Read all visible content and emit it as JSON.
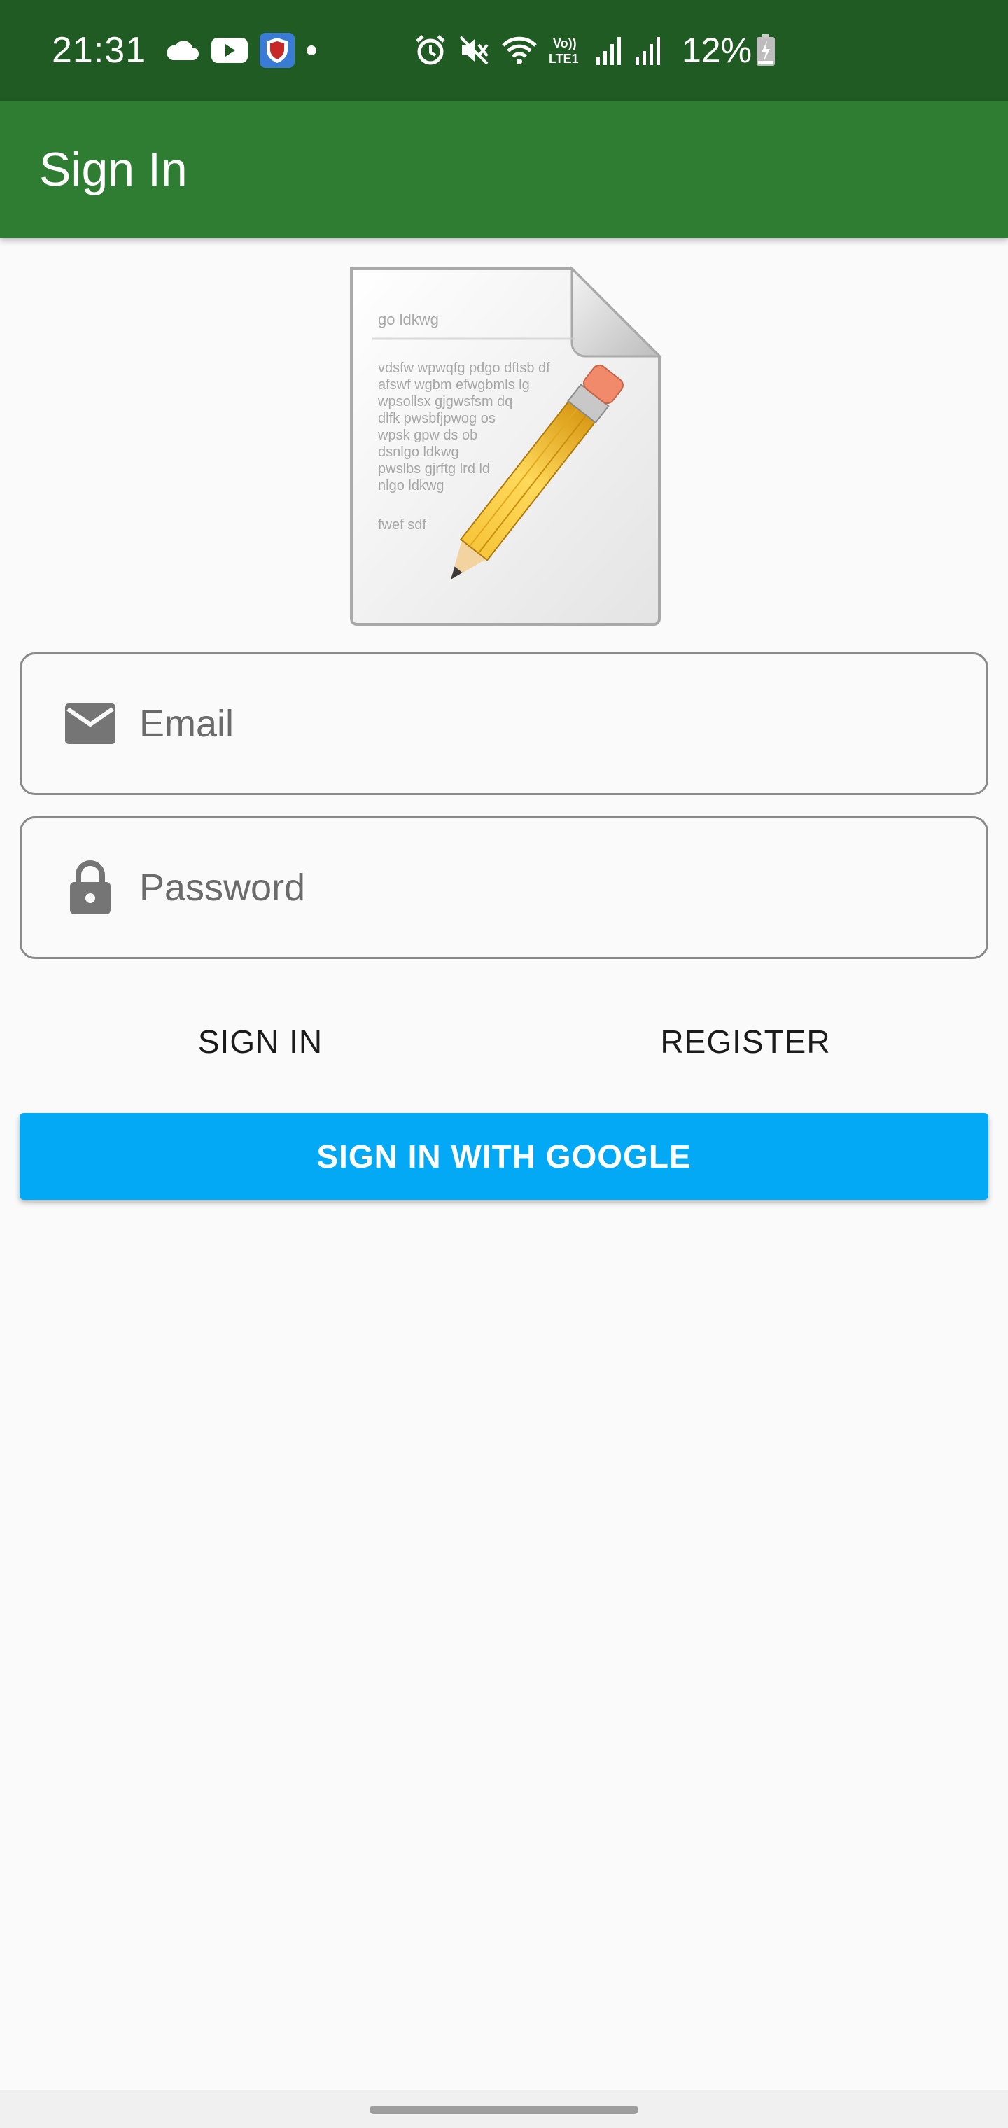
{
  "status_bar": {
    "time": "21:31",
    "battery": "12%",
    "background": "#1f5b22",
    "icons": [
      "cloud-icon",
      "youtube-icon",
      "shield-app-icon",
      "dot-icon",
      "alarm-icon",
      "mute-icon",
      "wifi-icon",
      "volte-icon",
      "signal-icon",
      "signal-icon-2",
      "battery-charging-icon"
    ]
  },
  "app_bar": {
    "title": "Sign In",
    "background": "#2e7d32"
  },
  "logo": {
    "icon": "document-pencil-icon",
    "doc_title": "go ldkwg",
    "doc_lines": [
      "vdsfw wpwqfg pdgo dftsb df",
      "afswf wgbm efwgbmls lg",
      "wpsollsx gjgwsfsm dq",
      "dlfk pwsbfjpwog os",
      "wpsk gpw ds ob",
      "dsnlgo ldkwg",
      "pwslbs gjrftg lrd ld",
      "nlgo ldkwg"
    ],
    "doc_footer": "fwef sdf"
  },
  "form": {
    "email": {
      "placeholder": "Email",
      "value": "",
      "icon": "email-icon"
    },
    "password": {
      "placeholder": "Password",
      "value": "",
      "icon": "lock-icon"
    }
  },
  "buttons": {
    "sign_in": "SIGN IN",
    "register": "REGISTER",
    "google": "SIGN IN WITH GOOGLE",
    "google_color": "#03a9f4"
  }
}
